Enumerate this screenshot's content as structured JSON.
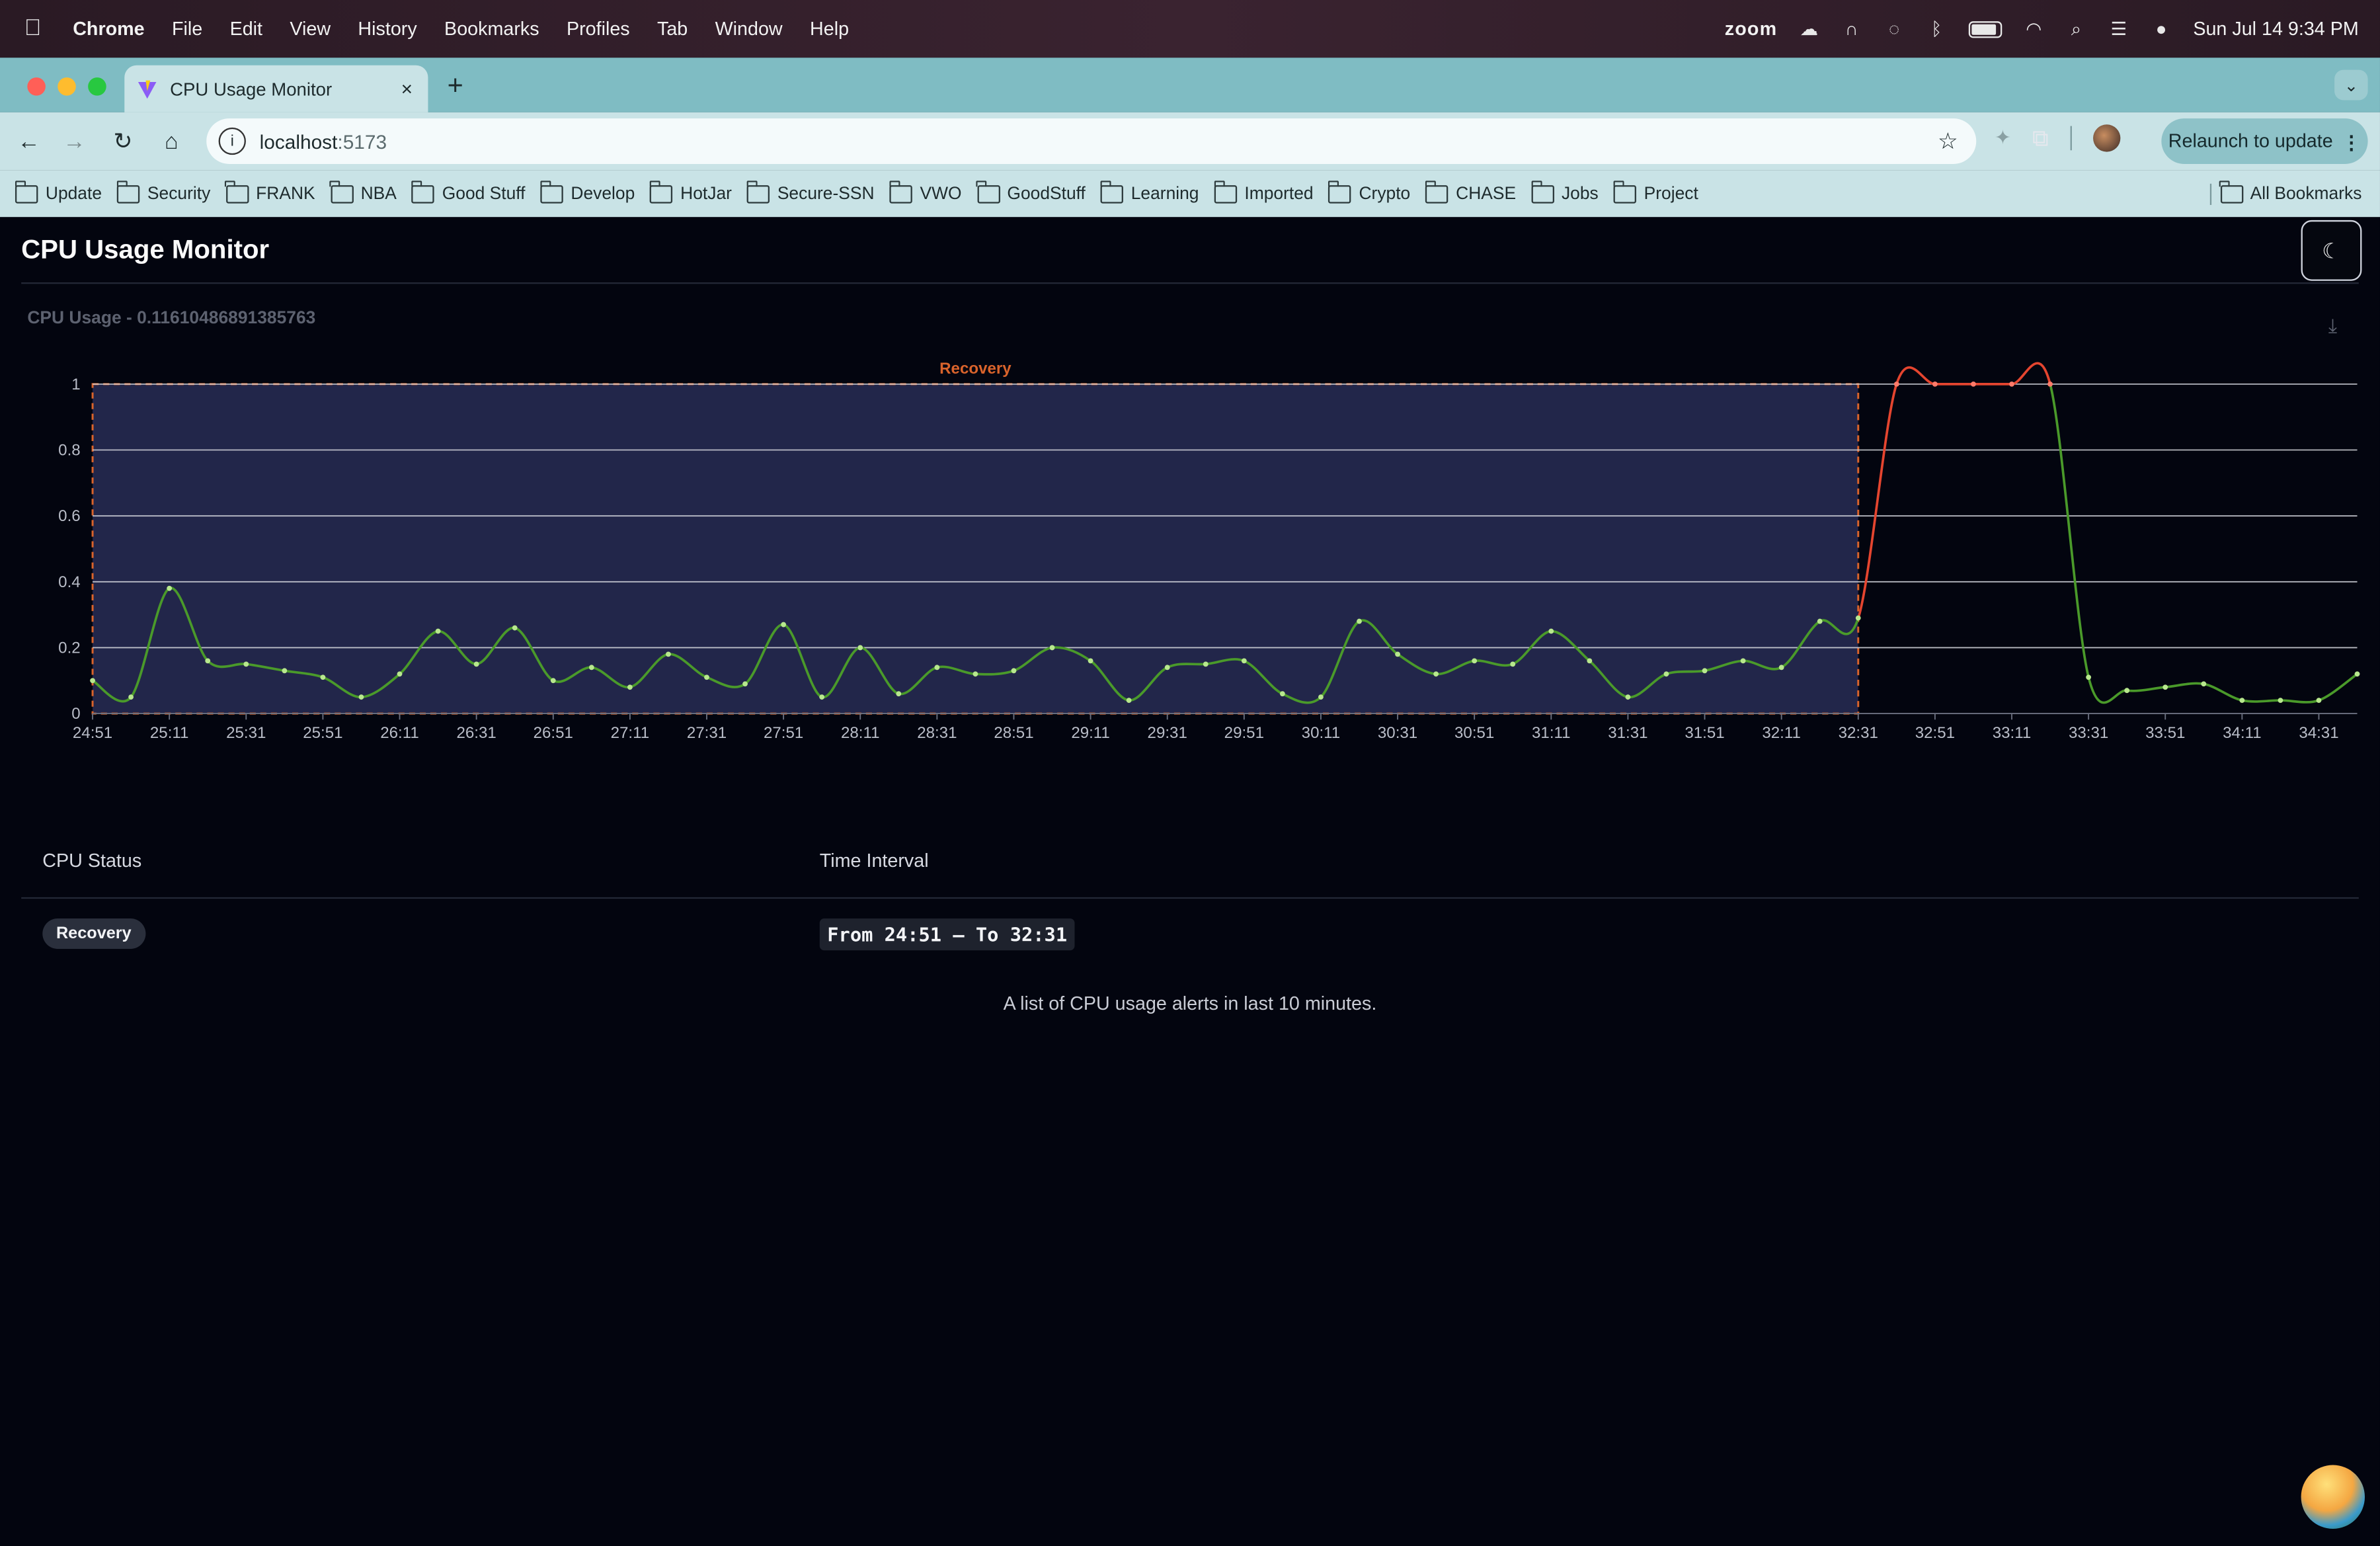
{
  "menubar": {
    "app": "Chrome",
    "items": [
      "File",
      "Edit",
      "View",
      "History",
      "Bookmarks",
      "Profiles",
      "Tab",
      "Window",
      "Help"
    ],
    "zoom": "zoom",
    "datetime": "Sun Jul 14  9:34 PM"
  },
  "tab": {
    "title": "CPU Usage Monitor",
    "close": "×",
    "new": "+"
  },
  "toolbar": {
    "url": "localhost",
    "port": ":5173",
    "relaunch": "Relaunch to update"
  },
  "bookmarks": {
    "items": [
      "Update",
      "Security",
      "FRANK",
      "NBA",
      "Good Stuff",
      "Develop",
      "HotJar",
      "Secure-SSN",
      "VWO",
      "GoodStuff",
      "Learning",
      "Imported",
      "Crypto",
      "CHASE",
      "Jobs",
      "Project"
    ],
    "all": "All Bookmarks"
  },
  "page": {
    "title": "CPU Usage Monitor",
    "chart_heading": "CPU Usage - 0.11610486891385763"
  },
  "chart_data": {
    "type": "line",
    "title": "CPU Usage - 0.11610486891385763",
    "ylim": [
      0,
      1
    ],
    "yticks": [
      "0",
      "0.2",
      "0.4",
      "0.6",
      "0.8",
      "1"
    ],
    "xticks": [
      "24:51",
      "25:11",
      "25:31",
      "25:51",
      "26:11",
      "26:31",
      "26:51",
      "27:11",
      "27:31",
      "27:51",
      "28:11",
      "28:31",
      "28:51",
      "29:11",
      "29:31",
      "29:51",
      "30:11",
      "30:31",
      "30:51",
      "31:11",
      "31:31",
      "31:51",
      "32:11",
      "32:31",
      "32:51",
      "33:11",
      "33:31",
      "33:51",
      "34:11",
      "34:31"
    ],
    "x_start_seconds_label": "24:51",
    "sample_interval_seconds": 10,
    "values": [
      0.1,
      0.05,
      0.38,
      0.16,
      0.15,
      0.13,
      0.11,
      0.05,
      0.12,
      0.25,
      0.15,
      0.26,
      0.1,
      0.14,
      0.08,
      0.18,
      0.11,
      0.09,
      0.27,
      0.05,
      0.2,
      0.06,
      0.14,
      0.12,
      0.13,
      0.2,
      0.16,
      0.04,
      0.14,
      0.15,
      0.16,
      0.06,
      0.05,
      0.28,
      0.18,
      0.12,
      0.16,
      0.15,
      0.25,
      0.16,
      0.05,
      0.12,
      0.13,
      0.16,
      0.14,
      0.28,
      0.29,
      1.0,
      1.0,
      1.0,
      1.0,
      1.0,
      0.11,
      0.07,
      0.08,
      0.09,
      0.04,
      0.04,
      0.04,
      0.12
    ],
    "alert_range": [
      47,
      51
    ],
    "alert_color": "#e5452f",
    "line_color": "#4a9a2a",
    "marker_color": "#b8e88e",
    "annotation": {
      "label": "Recovery",
      "from_index": 0,
      "to_index": 46,
      "color": "#d9632b",
      "fill": "#22264a"
    },
    "grid": true
  },
  "table": {
    "headers": [
      "CPU Status",
      "Time Interval"
    ],
    "rows": [
      {
        "status": "Recovery",
        "interval": "From 24:51 – To 32:31"
      }
    ],
    "caption": "A list of CPU usage alerts in last 10 minutes."
  }
}
